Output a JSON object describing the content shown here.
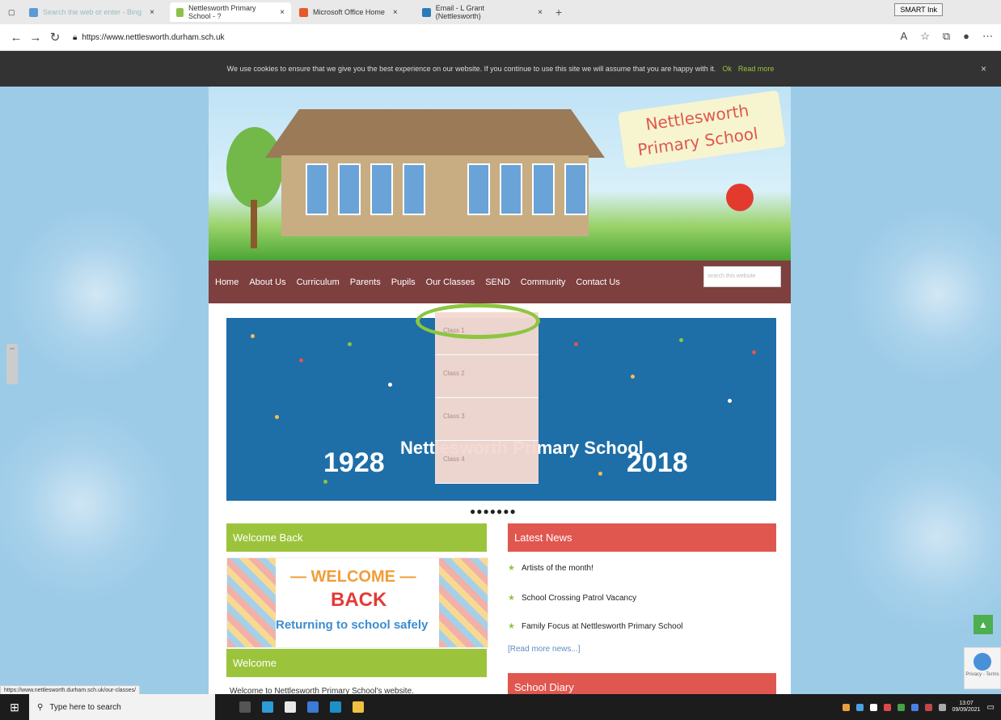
{
  "browser": {
    "tabs": [
      {
        "label": "Search the web or enter - Bing",
        "color": "#5b9bd5"
      },
      {
        "label": "Nettlesworth Primary School - ?",
        "color": "#8bc34a"
      },
      {
        "label": "Microsoft Office Home",
        "color": "#e55a2b"
      },
      {
        "label": "Email - L Grant (Nettlesworth)",
        "color": "#2a7ab8"
      }
    ],
    "new_tab": "+",
    "url": "https://www.nettlesworth.durham.sch.uk",
    "smart_ink": "SMART Ink",
    "status_url": "https://www.nettlesworth.durham.sch.uk/our-classes/"
  },
  "cookie": {
    "message": "We use cookies to ensure that we give you the best experience on our website. If you continue to use this site we will assume that you are happy with it.",
    "ok": "Ok",
    "read_more": "Read more",
    "close": "×"
  },
  "header": {
    "school_line1": "Nettlesworth",
    "school_line2": "Primary School"
  },
  "nav": {
    "items": [
      "Home",
      "About Us",
      "Curriculum",
      "Parents",
      "Pupils",
      "Our Classes",
      "SEND",
      "Community",
      "Contact Us"
    ],
    "search_placeholder": "search this website"
  },
  "dropdown": {
    "items": [
      "Class 1",
      "Class 2",
      "Class 3",
      "Class 4"
    ]
  },
  "slider": {
    "year_left": "1928",
    "year_right": "2018",
    "title": "Nettlesworth Primary School",
    "pager": "●●●●●●●"
  },
  "welcome_back": {
    "heading": "Welcome Back",
    "banner_line1": "— WELCOME —",
    "banner_line2": "BACK",
    "banner_line3": "Returning to school safely"
  },
  "welcome": {
    "heading": "Welcome",
    "text": "Welcome to Nettlesworth Primary School's website."
  },
  "latest_news": {
    "heading": "Latest News",
    "items": [
      "Artists of the month!",
      "School Crossing Patrol Vacancy",
      "Family Focus at Nettlesworth Primary School"
    ],
    "read_more": "[Read more news...]"
  },
  "school_diary": {
    "heading": "School Diary"
  },
  "taskbar": {
    "search_placeholder": "Type here to search",
    "time": "13:07",
    "date": "09/09/2021"
  }
}
